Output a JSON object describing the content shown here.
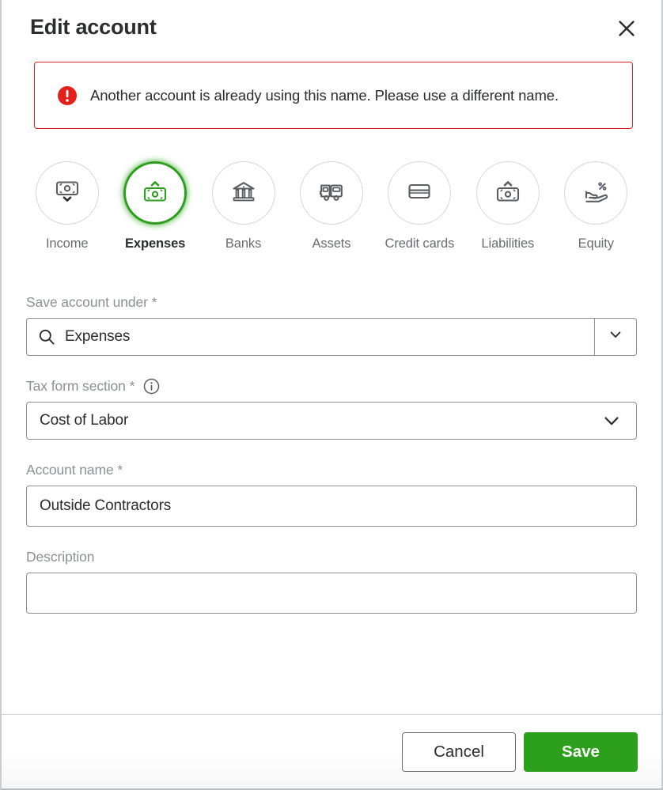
{
  "dialog": {
    "title": "Edit account",
    "close_label": "Close",
    "close_icon": "close-icon"
  },
  "error": {
    "icon": "error-exclamation-icon",
    "message": "Another account is already using this name. Please use a different name."
  },
  "categories": [
    {
      "label": "Income",
      "icon": "banknote-down-icon",
      "selected": false
    },
    {
      "label": "Expenses",
      "icon": "banknote-up-icon",
      "selected": true
    },
    {
      "label": "Banks",
      "icon": "bank-building-icon",
      "selected": false
    },
    {
      "label": "Assets",
      "icon": "delivery-truck-icon",
      "selected": false
    },
    {
      "label": "Credit cards",
      "icon": "credit-card-icon",
      "selected": false
    },
    {
      "label": "Liabilities",
      "icon": "banknote-up-icon",
      "selected": false
    },
    {
      "label": "Equity",
      "icon": "hand-percent-icon",
      "selected": false
    }
  ],
  "form": {
    "save_account_under": {
      "label": "Save account under *",
      "value": "Expenses",
      "placeholder": "",
      "search_icon": "search-icon",
      "toggle_icon": "chevron-down-icon"
    },
    "tax_form_section": {
      "label": "Tax form section *",
      "info_icon": "info-circle-icon",
      "value": "Cost of Labor",
      "toggle_icon": "chevron-down-icon"
    },
    "account_name": {
      "label": "Account name *",
      "value": "Outside Contractors",
      "placeholder": ""
    },
    "description": {
      "label": "Description",
      "value": "",
      "placeholder": ""
    }
  },
  "footer": {
    "cancel_label": "Cancel",
    "save_label": "Save"
  },
  "colors": {
    "brand_green": "#2ca01c",
    "error_red": "#e3211a",
    "label_gray": "#8d9096",
    "text_dark": "#2b2c2e",
    "border_gray": "#d4d7dc"
  }
}
